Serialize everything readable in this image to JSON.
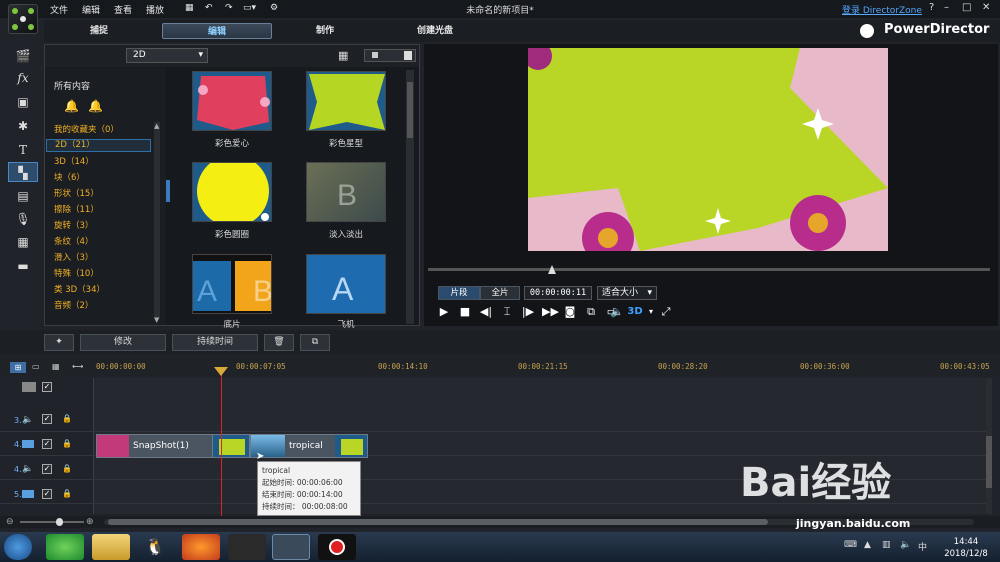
{
  "menu": {
    "items": [
      "文件",
      "编辑",
      "查看",
      "播放"
    ]
  },
  "window": {
    "title": "未命名的新项目*",
    "signin": "登录 DirectorZone",
    "help": "?",
    "minimize": "–",
    "maximize": "□",
    "close": "✕"
  },
  "tabs": [
    {
      "label": "捕捉"
    },
    {
      "label": "编辑"
    },
    {
      "label": "制作"
    },
    {
      "label": "创建光盘"
    }
  ],
  "brand": "PowerDirector",
  "library": {
    "dropdown": "2D",
    "all_content": "所有内容",
    "categories": [
      {
        "label": "我的收藏夹（0）"
      },
      {
        "label": "2D（21）"
      },
      {
        "label": "3D（14）"
      },
      {
        "label": "块（6）"
      },
      {
        "label": "形状（15）"
      },
      {
        "label": "擦除（11）"
      },
      {
        "label": "旋转（3）"
      },
      {
        "label": "条纹（4）"
      },
      {
        "label": "滑入（3）"
      },
      {
        "label": "特殊（10）"
      },
      {
        "label": "类 3D（34）"
      },
      {
        "label": "音频（2）"
      }
    ],
    "thumbs": [
      {
        "label": "彩色爱心"
      },
      {
        "label": "彩色星型"
      },
      {
        "label": "彩色圆圈"
      },
      {
        "label": "淡入淡出"
      },
      {
        "label": "底片"
      },
      {
        "label": "飞机"
      }
    ]
  },
  "preview": {
    "mode_clip": "片段",
    "mode_full": "全片",
    "timecode": "00:00:00:11",
    "fit": "适合大小",
    "threeD": "3D"
  },
  "actions": {
    "modify": "修改",
    "duration": "持续时间"
  },
  "timeline": {
    "ticks": [
      "00:00:00:00",
      "00:00:07:05",
      "00:00:14:10",
      "00:00:21:15",
      "00:00:28:20",
      "00:00:36:00",
      "00:00:43:05"
    ],
    "tracks": [
      {
        "name": "3."
      },
      {
        "name": "4."
      },
      {
        "name": "4."
      },
      {
        "name": "5."
      }
    ],
    "clips": [
      {
        "label": "SnapShot(1)"
      },
      {
        "label": "tropical"
      }
    ],
    "tooltip": {
      "title": "tropical",
      "start": "起始时间: 00:00:06:00",
      "end": "结束时间: 00:00:14:00",
      "duration": "持续时间： 00:00:08:00"
    }
  },
  "taskbar": {
    "time": "14:44",
    "date": "2018/12/8"
  },
  "watermark": {
    "text": "Bai经验",
    "url": "jingyan.baidu.com"
  }
}
